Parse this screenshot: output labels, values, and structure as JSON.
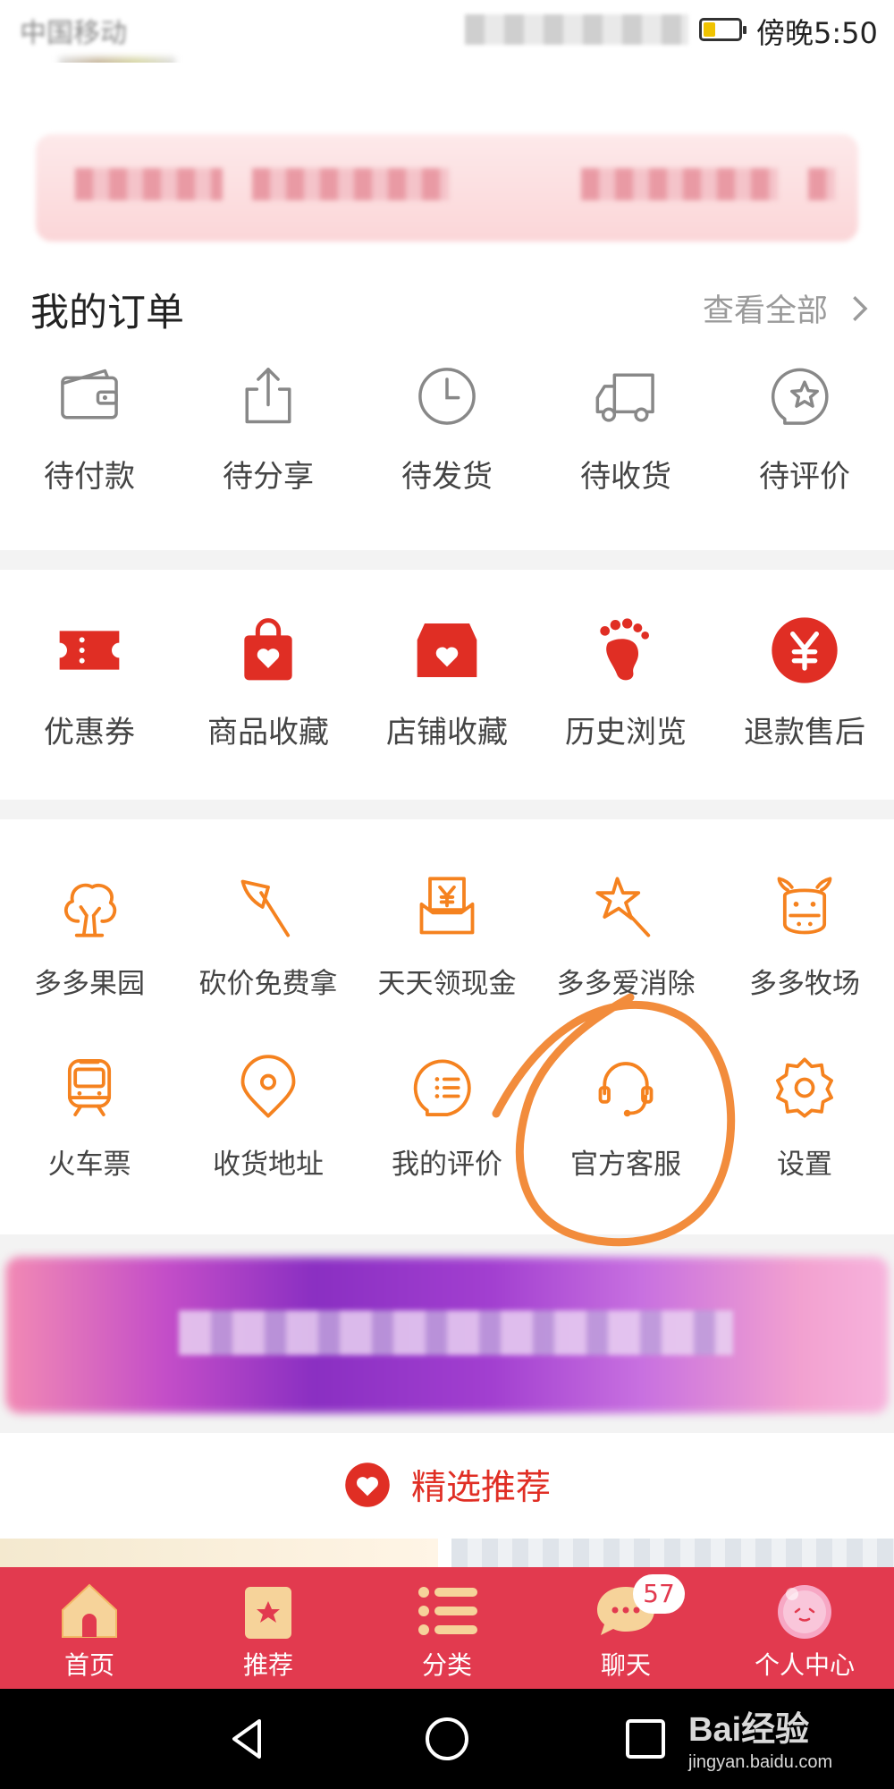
{
  "status_bar": {
    "carrier": "中国移动",
    "time": "傍晚5:50",
    "battery_level": 0.35
  },
  "orders": {
    "title": "我的订单",
    "view_all": "查看全部",
    "items": [
      {
        "icon": "wallet-icon",
        "label": "待付款"
      },
      {
        "icon": "share-icon",
        "label": "待分享"
      },
      {
        "icon": "clock-icon",
        "label": "待发货"
      },
      {
        "icon": "truck-icon",
        "label": "待收货"
      },
      {
        "icon": "review-star-icon",
        "label": "待评价"
      }
    ]
  },
  "services": [
    {
      "icon": "coupon-icon",
      "label": "优惠券"
    },
    {
      "icon": "favorite-bag-icon",
      "label": "商品收藏"
    },
    {
      "icon": "store-favorite-icon",
      "label": "店铺收藏"
    },
    {
      "icon": "footprint-icon",
      "label": "历史浏览"
    },
    {
      "icon": "refund-yen-icon",
      "label": "退款售后"
    }
  ],
  "tools": {
    "row1": [
      {
        "icon": "tree-icon",
        "label": "多多果园"
      },
      {
        "icon": "axe-icon",
        "label": "砍价免费拿"
      },
      {
        "icon": "cash-envelope-icon",
        "label": "天天领现金"
      },
      {
        "icon": "star-wand-icon",
        "label": "多多爱消除"
      },
      {
        "icon": "cow-icon",
        "label": "多多牧场"
      }
    ],
    "row2": [
      {
        "icon": "train-icon",
        "label": "火车票"
      },
      {
        "icon": "location-pin-icon",
        "label": "收货地址"
      },
      {
        "icon": "comment-list-icon",
        "label": "我的评价"
      },
      {
        "icon": "headset-icon",
        "label": "官方客服"
      },
      {
        "icon": "gear-icon",
        "label": "设置"
      }
    ]
  },
  "recommend": {
    "title": "精选推荐"
  },
  "tab_bar": {
    "tabs": [
      {
        "icon": "home-icon",
        "label": "首页"
      },
      {
        "icon": "recommend-bag-icon",
        "label": "推荐"
      },
      {
        "icon": "category-list-icon",
        "label": "分类"
      },
      {
        "icon": "chat-bubble-icon",
        "label": "聊天",
        "badge": "57"
      },
      {
        "icon": "avatar-icon",
        "label": "个人中心"
      }
    ]
  },
  "watermark": {
    "main": "Bai经验",
    "sub": "jingyan.baidu.com"
  },
  "colors": {
    "brand_red": "#e02e24",
    "tool_orange": "#f5821f",
    "tab_bar": "#e23a4f",
    "annotation": "#f28c3c"
  }
}
